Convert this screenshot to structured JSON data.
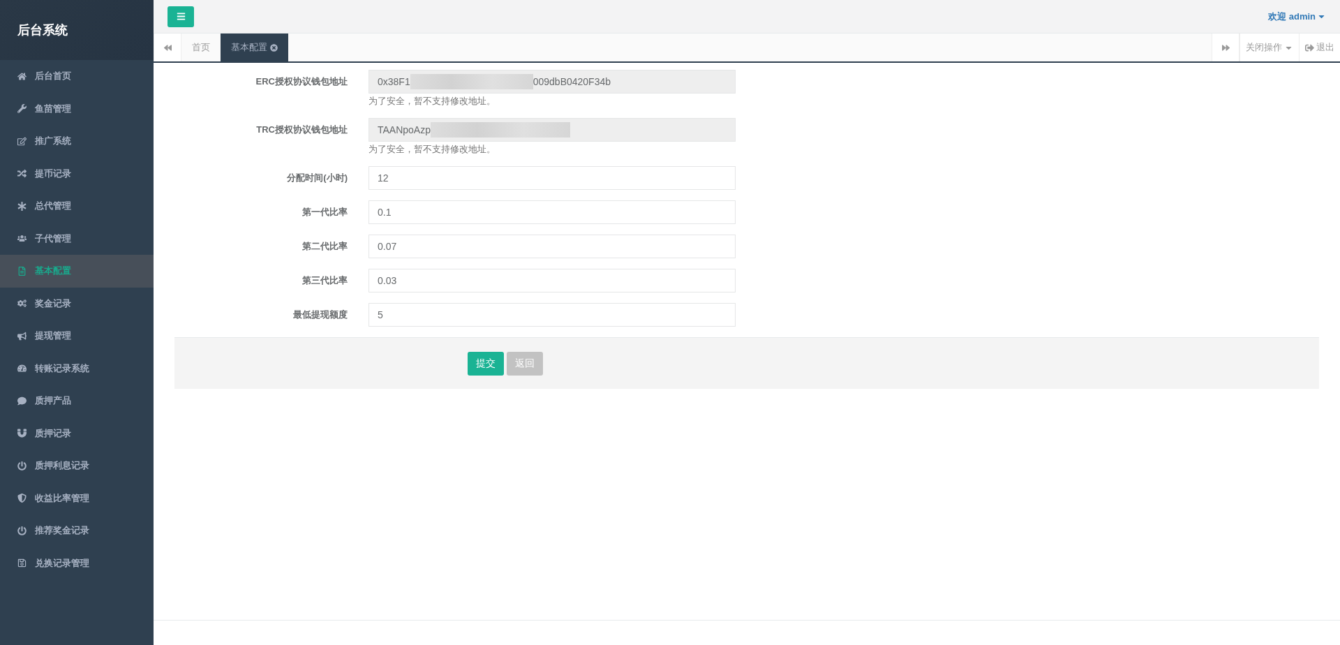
{
  "sidebar": {
    "title": "后台系统",
    "items": [
      {
        "label": "后台首页",
        "selected": false
      },
      {
        "label": "鱼苗管理",
        "selected": false
      },
      {
        "label": "推广系统",
        "selected": false
      },
      {
        "label": "提币记录",
        "selected": false
      },
      {
        "label": "总代管理",
        "selected": false
      },
      {
        "label": "子代管理",
        "selected": false
      },
      {
        "label": "基本配置",
        "selected": true
      },
      {
        "label": "奖金记录",
        "selected": false
      },
      {
        "label": "提现管理",
        "selected": false
      },
      {
        "label": "转账记录系统",
        "selected": false
      },
      {
        "label": "质押产品",
        "selected": false
      },
      {
        "label": "质押记录",
        "selected": false
      },
      {
        "label": "质押利息记录",
        "selected": false
      },
      {
        "label": "收益比率管理",
        "selected": false
      },
      {
        "label": "推荐奖金记录",
        "selected": false
      },
      {
        "label": "兑换记录管理",
        "selected": false
      }
    ]
  },
  "header": {
    "user": "欢迎 admin"
  },
  "tabs": [
    {
      "label": "首页",
      "selected": false,
      "closable": false
    },
    {
      "label": "基本配置",
      "selected": true,
      "closable": true
    }
  ],
  "tab_actions": {
    "close_menu": "关闭操作",
    "logout": "退出"
  },
  "form": {
    "fields": [
      {
        "label": "ERC授权协议钱包地址",
        "kind": "redacted",
        "value_start": "0x38F1",
        "value_end": "009dbB0420F34b",
        "help": "为了安全，暂不支持修改地址。"
      },
      {
        "label": "TRC授权协议钱包地址",
        "kind": "redacted",
        "value_start": "TAANpoAzp",
        "help": "为了安全，暂不支持修改地址。"
      },
      {
        "label": "分配时间(小时)",
        "kind": "text",
        "value": "12"
      },
      {
        "label": "第一代比率",
        "kind": "text",
        "value": "0.1"
      },
      {
        "label": "第二代比率",
        "kind": "text",
        "value": "0.07"
      },
      {
        "label": "第三代比率",
        "kind": "text",
        "value": "0.03"
      },
      {
        "label": "最低提现额度",
        "kind": "text",
        "value": "5"
      }
    ],
    "buttons": [
      {
        "label": "提交",
        "kind": "primary"
      },
      {
        "label": "返回",
        "kind": "secondary"
      }
    ]
  }
}
